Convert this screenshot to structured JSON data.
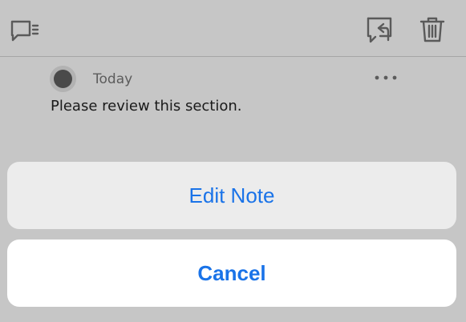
{
  "toolbar": {
    "left_icon": "comment-list-icon",
    "right_icons": [
      "reply-comment-icon",
      "trash-icon"
    ]
  },
  "comment": {
    "avatar_icon": "avatar-icon",
    "date": "Today",
    "more_icon": "more-horizontal-icon",
    "text": "Please review this section."
  },
  "sheet": {
    "edit_label": "Edit Note",
    "cancel_label": "Cancel"
  },
  "colors": {
    "accent": "#1a73e8",
    "backdrop": "#c6c6c6",
    "sheet_button": "#ececec",
    "cancel_button": "#ffffff"
  }
}
